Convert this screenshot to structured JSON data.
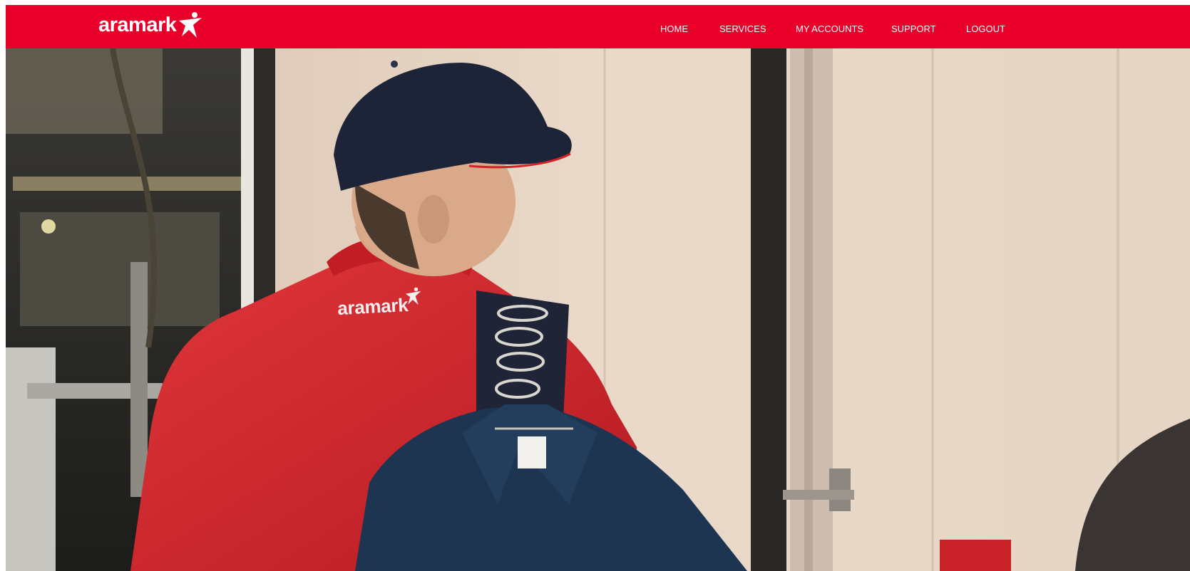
{
  "brand": {
    "logo_text": "aramark",
    "color": "#e8002b"
  },
  "nav": {
    "items": [
      {
        "label": "HOME"
      },
      {
        "label": "SERVICES"
      },
      {
        "label": "MY ACCOUNTS"
      },
      {
        "label": "SUPPORT"
      },
      {
        "label": "LOGOUT"
      }
    ]
  },
  "hero": {
    "shirt_logo_text": "aramark",
    "colors": {
      "wall": "#e3d0bf",
      "shirt": "#d42328",
      "cap": "#1e2438",
      "garment": "#1e3552"
    }
  }
}
